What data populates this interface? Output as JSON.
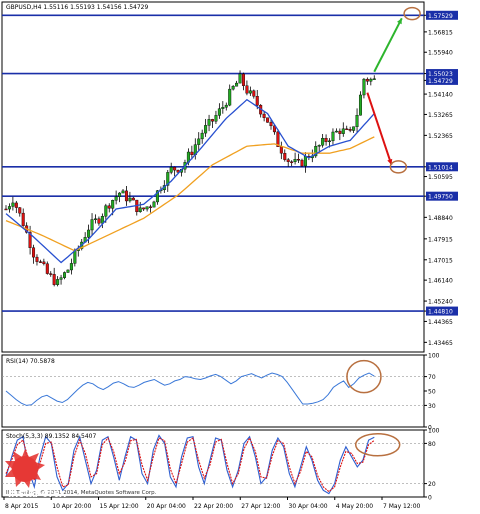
{
  "chart_data": {
    "type": "candlestick",
    "symbol_header": "GBPUSD,H4  1.55116 1.55193 1.54156 1.54729",
    "y_axis_labels": [
      "1.57529",
      "1.56815",
      "1.55940",
      "1.55023",
      "1.54729",
      "1.54140",
      "1.53265",
      "1.52365",
      "1.51014",
      "1.50595",
      "1.49750",
      "1.48840",
      "1.47915",
      "1.47015",
      "1.46140",
      "1.45240",
      "1.44810",
      "1.44365",
      "1.43465"
    ],
    "y_range": [
      1.4305,
      1.581
    ],
    "x_axis_labels": [
      "8 Apr 2015",
      "10 Apr 20:00",
      "15 Apr 12:00",
      "20 Apr 04:00",
      "22 Apr 20:00",
      "27 Apr 12:00",
      "30 Apr 04:00",
      "4 May 20:00",
      "7 May 12:00"
    ],
    "horizontal_levels": [
      1.57529,
      1.55023,
      1.51014,
      1.4975,
      1.4481
    ],
    "highlighted_labels": [
      "1.57529",
      "1.55023",
      "1.54729",
      "1.51014",
      "1.49750",
      "1.44810"
    ],
    "candle_count": 108,
    "path_points": [
      {
        "i": 0,
        "p": 1.492
      },
      {
        "i": 2,
        "p": 1.4965
      },
      {
        "i": 5,
        "p": 1.486
      },
      {
        "i": 8,
        "p": 1.473
      },
      {
        "i": 12,
        "p": 1.464
      },
      {
        "i": 15,
        "p": 1.46
      },
      {
        "i": 18,
        "p": 1.466
      },
      {
        "i": 21,
        "p": 1.475
      },
      {
        "i": 24,
        "p": 1.484
      },
      {
        "i": 27,
        "p": 1.488
      },
      {
        "i": 30,
        "p": 1.4945
      },
      {
        "i": 33,
        "p": 1.499
      },
      {
        "i": 36,
        "p": 1.496
      },
      {
        "i": 39,
        "p": 1.491
      },
      {
        "i": 42,
        "p": 1.494
      },
      {
        "i": 45,
        "p": 1.502
      },
      {
        "i": 48,
        "p": 1.509
      },
      {
        "i": 51,
        "p": 1.51
      },
      {
        "i": 54,
        "p": 1.517
      },
      {
        "i": 57,
        "p": 1.525
      },
      {
        "i": 60,
        "p": 1.53
      },
      {
        "i": 63,
        "p": 1.536
      },
      {
        "i": 66,
        "p": 1.544
      },
      {
        "i": 68,
        "p": 1.548
      },
      {
        "i": 70,
        "p": 1.543
      },
      {
        "i": 73,
        "p": 1.537
      },
      {
        "i": 76,
        "p": 1.53
      },
      {
        "i": 79,
        "p": 1.52
      },
      {
        "i": 82,
        "p": 1.513
      },
      {
        "i": 85,
        "p": 1.511
      },
      {
        "i": 88,
        "p": 1.515
      },
      {
        "i": 91,
        "p": 1.519
      },
      {
        "i": 94,
        "p": 1.523
      },
      {
        "i": 97,
        "p": 1.526
      },
      {
        "i": 100,
        "p": 1.524
      },
      {
        "i": 102,
        "p": 1.533
      },
      {
        "i": 104,
        "p": 1.548
      },
      {
        "i": 107,
        "p": 1.5473
      }
    ],
    "ma_fast": [
      {
        "i": 0,
        "p": 1.49
      },
      {
        "i": 8,
        "p": 1.48
      },
      {
        "i": 16,
        "p": 1.469
      },
      {
        "i": 24,
        "p": 1.479
      },
      {
        "i": 32,
        "p": 1.492
      },
      {
        "i": 40,
        "p": 1.494
      },
      {
        "i": 48,
        "p": 1.504
      },
      {
        "i": 56,
        "p": 1.517
      },
      {
        "i": 64,
        "p": 1.531
      },
      {
        "i": 70,
        "p": 1.539
      },
      {
        "i": 76,
        "p": 1.533
      },
      {
        "i": 82,
        "p": 1.519
      },
      {
        "i": 88,
        "p": 1.514
      },
      {
        "i": 94,
        "p": 1.519
      },
      {
        "i": 100,
        "p": 1.5215
      },
      {
        "i": 107,
        "p": 1.533
      }
    ],
    "ma_slow": [
      {
        "i": 0,
        "p": 1.487
      },
      {
        "i": 10,
        "p": 1.481
      },
      {
        "i": 20,
        "p": 1.474
      },
      {
        "i": 30,
        "p": 1.481
      },
      {
        "i": 40,
        "p": 1.488
      },
      {
        "i": 50,
        "p": 1.498
      },
      {
        "i": 60,
        "p": 1.511
      },
      {
        "i": 70,
        "p": 1.519
      },
      {
        "i": 78,
        "p": 1.52
      },
      {
        "i": 86,
        "p": 1.516
      },
      {
        "i": 94,
        "p": 1.516
      },
      {
        "i": 100,
        "p": 1.518
      },
      {
        "i": 107,
        "p": 1.523
      }
    ],
    "annotations": [
      {
        "kind": "arrow",
        "color": "#2db52d",
        "from": {
          "i": 107,
          "p": 1.551
        },
        "to": {
          "i": 115,
          "p": 1.574
        }
      },
      {
        "kind": "arrow",
        "color": "#dd1111",
        "from": {
          "i": 105,
          "p": 1.542
        },
        "to": {
          "i": 112,
          "p": 1.511
        }
      },
      {
        "kind": "ellipse",
        "color": "#b87040",
        "center": {
          "i": 118,
          "p": 1.576
        }
      },
      {
        "kind": "ellipse",
        "color": "#b87040",
        "center": {
          "i": 114,
          "p": 1.5101
        }
      }
    ],
    "rsi": {
      "label": "RSI(14) 70.5878",
      "axis_labels": [
        "100",
        "70",
        "50",
        "30",
        "0"
      ],
      "range": [
        0,
        100
      ],
      "values": [
        50,
        44,
        38,
        33,
        30,
        31,
        37,
        42,
        44,
        40,
        36,
        34,
        38,
        45,
        52,
        58,
        62,
        60,
        55,
        52,
        56,
        61,
        63,
        60,
        56,
        55,
        58,
        62,
        64,
        66,
        62,
        58,
        60,
        64,
        66,
        70,
        69,
        67,
        66,
        68,
        71,
        73,
        70,
        65,
        60,
        64,
        70,
        72,
        74,
        71,
        68,
        72,
        75,
        73,
        70,
        62,
        52,
        42,
        32,
        32,
        33,
        35,
        38,
        45,
        55,
        60,
        64,
        55,
        60,
        68,
        72,
        75,
        70.59
      ]
    },
    "stochastic": {
      "label": "Stoch(5,3,3) 89.1352 84.5407",
      "axis_labels": [
        "100",
        "80",
        "20",
        "0"
      ],
      "range": [
        0,
        100
      ],
      "main": [
        30,
        60,
        85,
        90,
        40,
        15,
        60,
        90,
        80,
        30,
        10,
        20,
        70,
        90,
        55,
        20,
        40,
        85,
        90,
        60,
        25,
        60,
        90,
        85,
        35,
        20,
        70,
        92,
        80,
        30,
        15,
        60,
        88,
        90,
        45,
        20,
        55,
        88,
        85,
        40,
        15,
        40,
        80,
        90,
        60,
        20,
        30,
        70,
        88,
        75,
        35,
        15,
        45,
        75,
        55,
        25,
        10,
        5,
        20,
        55,
        75,
        60,
        45,
        55,
        85,
        89.14
      ],
      "signal": [
        35,
        55,
        78,
        85,
        55,
        25,
        50,
        80,
        82,
        45,
        15,
        18,
        60,
        85,
        65,
        30,
        35,
        78,
        88,
        68,
        35,
        52,
        84,
        86,
        48,
        25,
        60,
        88,
        84,
        42,
        20,
        50,
        82,
        88,
        55,
        28,
        48,
        82,
        86,
        50,
        20,
        35,
        72,
        88,
        68,
        30,
        28,
        62,
        84,
        80,
        45,
        20,
        38,
        68,
        60,
        32,
        15,
        8,
        15,
        45,
        68,
        65,
        50,
        52,
        78,
        84.54
      ]
    },
    "watermark": "InstaForex",
    "copyright": "IFX Trading, © 2001-2014, MetaQuotes Software Corp."
  }
}
